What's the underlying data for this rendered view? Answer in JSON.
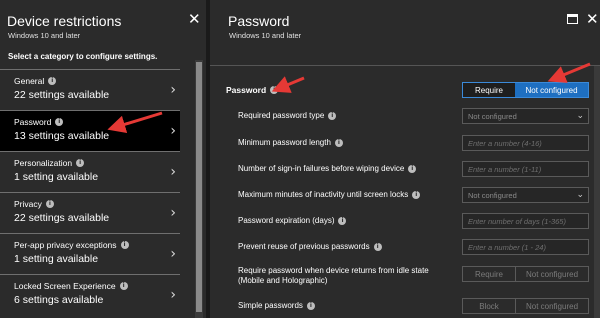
{
  "left_panel": {
    "title": "Device restrictions",
    "subtitle": "Windows 10 and later",
    "prompt": "Select a category to configure settings.",
    "close_glyph": "✕",
    "categories": [
      {
        "name": "General",
        "count": "22 settings available"
      },
      {
        "name": "Password",
        "count": "13 settings available"
      },
      {
        "name": "Personalization",
        "count": "1 setting available"
      },
      {
        "name": "Privacy",
        "count": "22 settings available"
      },
      {
        "name": "Per-app privacy exceptions",
        "count": "1 setting available"
      },
      {
        "name": "Locked Screen Experience",
        "count": "6 settings available"
      }
    ]
  },
  "right_panel": {
    "title": "Password",
    "subtitle": "Windows 10 and later",
    "close_glyph": "✕",
    "password_label": "Password",
    "password_toggle": {
      "require": "Require",
      "not_configured": "Not configured"
    },
    "settings": [
      {
        "label": "Required password type",
        "value": "Not configured"
      },
      {
        "label": "Minimum password length",
        "placeholder": "Enter a number (4-16)"
      },
      {
        "label": "Number of sign-in failures before wiping device",
        "placeholder": "Enter a number (1-11)"
      },
      {
        "label": "Maximum minutes of inactivity until screen locks",
        "value": "Not configured"
      },
      {
        "label": "Password expiration (days)",
        "placeholder": "Enter number of days (1-365)"
      },
      {
        "label": "Prevent reuse of previous passwords",
        "placeholder": "Enter a number (1 - 24)"
      },
      {
        "label": "Require password when device returns from idle state (Mobile and Holographic)",
        "toggle": {
          "a": "Require",
          "b": "Not configured"
        }
      },
      {
        "label": "Simple passwords",
        "toggle": {
          "a": "Block",
          "b": "Not configured"
        }
      }
    ]
  },
  "icons": {
    "info": "i",
    "chevron": "›",
    "caret": "⌄"
  },
  "colors": {
    "accent": "#1e6fc1",
    "arrow": "#e53935",
    "panel_bg": "#2b2b2b"
  }
}
